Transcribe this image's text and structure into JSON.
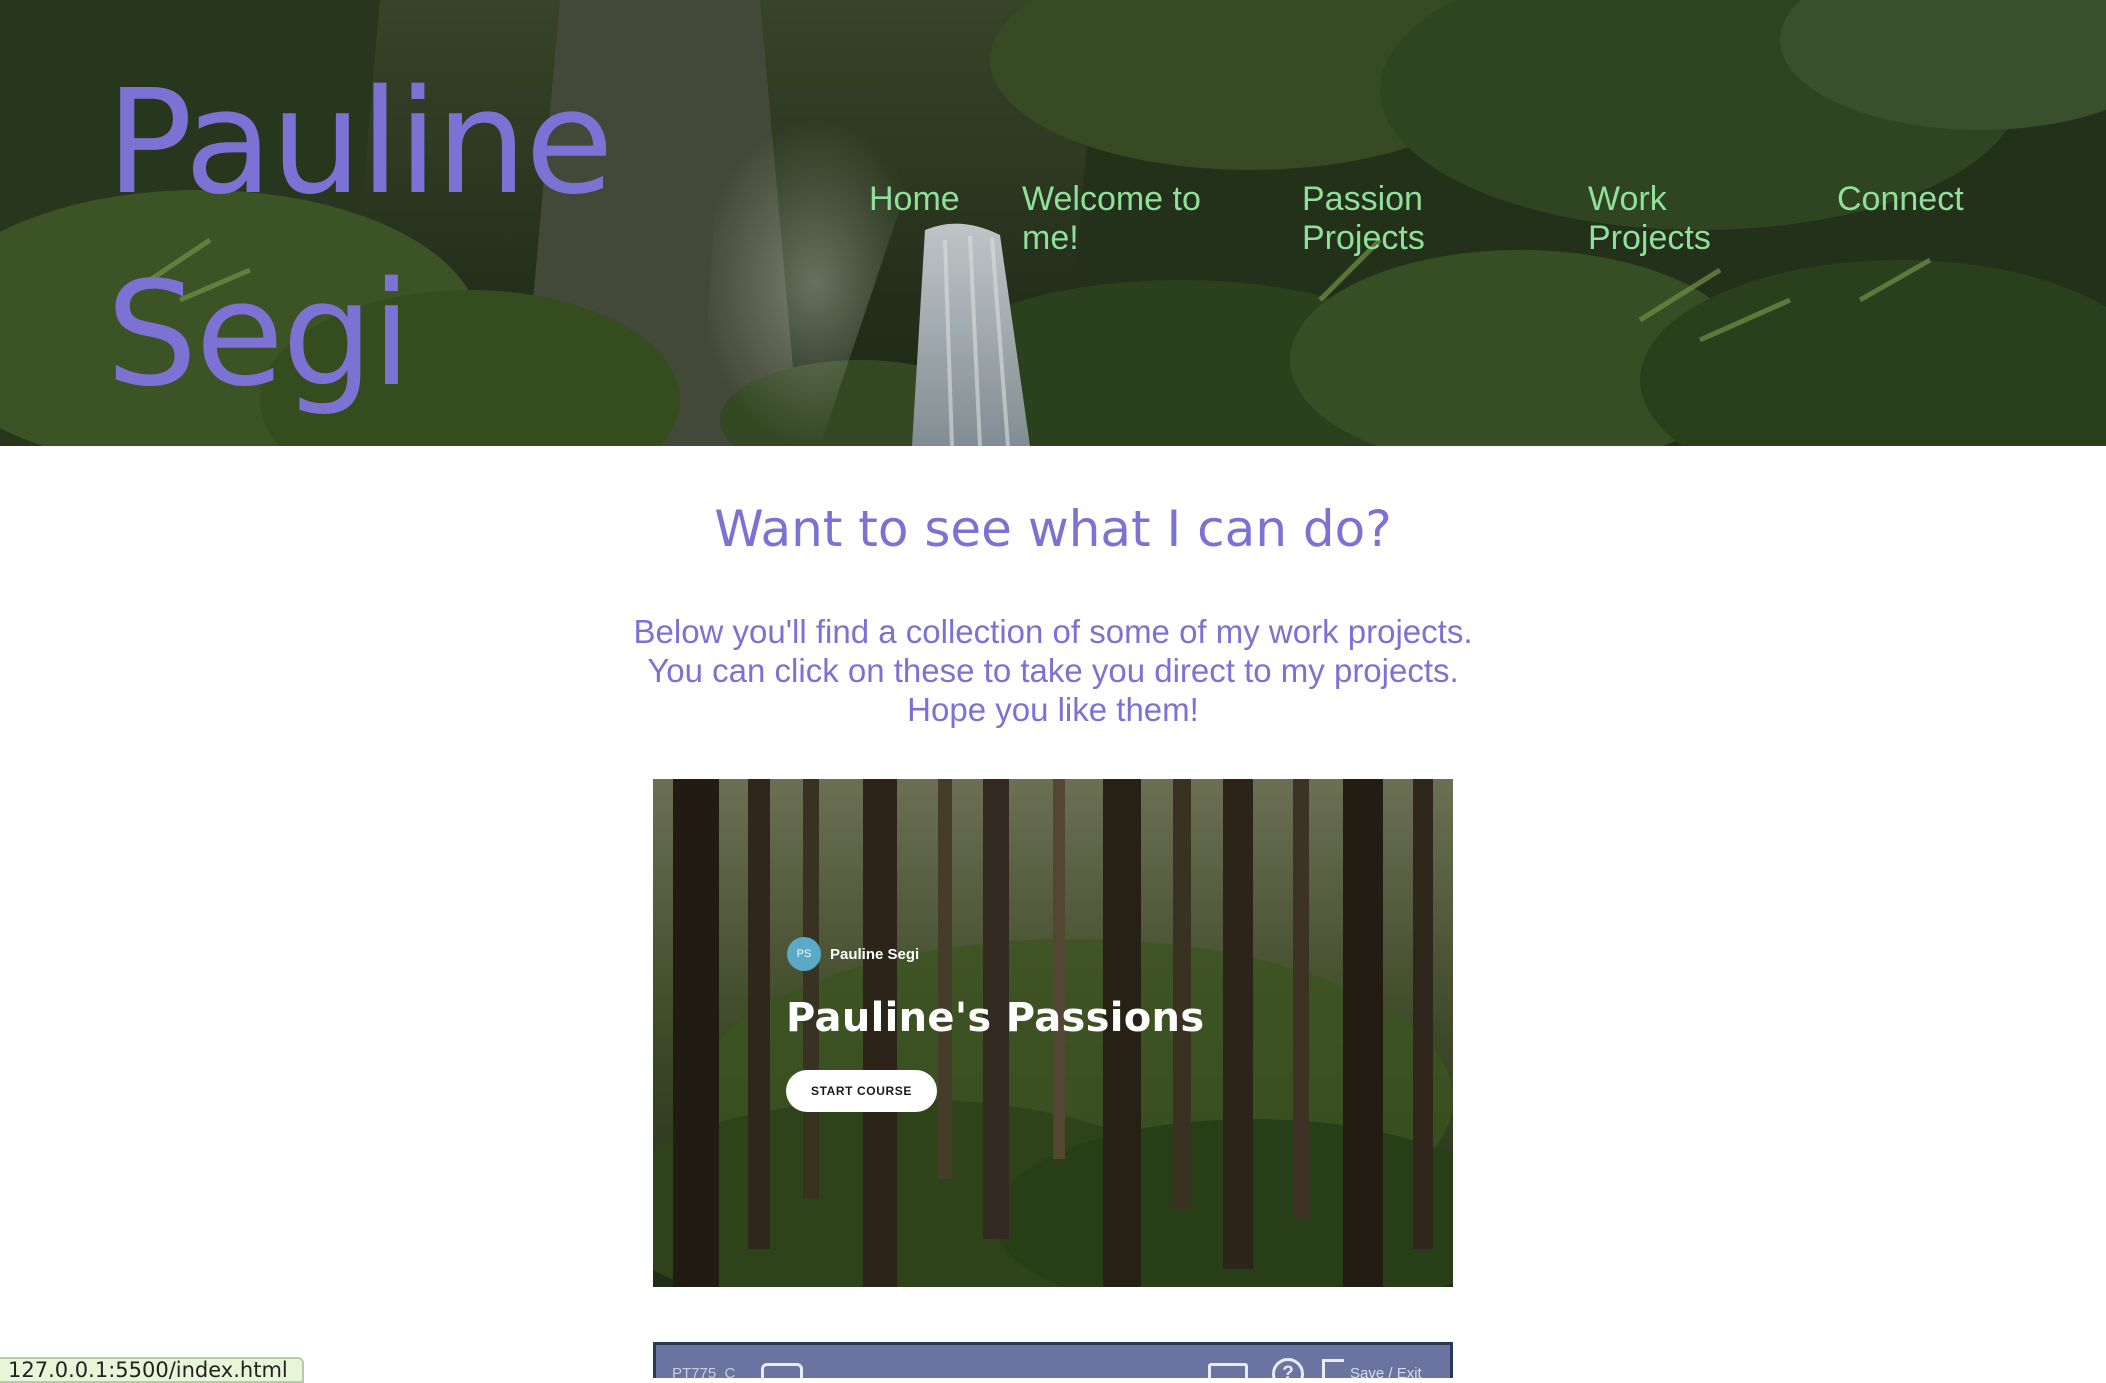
{
  "header": {
    "name_line1": "Pauline",
    "name_line2": "Segi",
    "nav": {
      "home": "Home",
      "welcome": "Welcome to me!",
      "passion": "Passion Projects",
      "work": "Work Projects",
      "connect": "Connect"
    }
  },
  "main": {
    "headline": "Want to see what I can do?",
    "intro_lines": [
      "Below you'll find a collection of some of my work projects.",
      "You can click on these to take you direct to my projects.",
      "Hope you like them!"
    ]
  },
  "project_card": {
    "avatar_initials": "PS",
    "author": "Pauline Segi",
    "title": "Pauline's Passions",
    "button": "START COURSE"
  },
  "project_card_2": {
    "code": "PT775_C",
    "save_label": "Save / Exit",
    "icons": [
      "menu-icon",
      "check-icon",
      "help-icon",
      "exit-icon"
    ]
  },
  "status_bar": {
    "url": "127.0.0.1:5500/index.html"
  },
  "colors": {
    "accent_purple": "#7b72d4",
    "nav_green": "#8fe098",
    "avatar_blue": "#5aa9c6"
  }
}
